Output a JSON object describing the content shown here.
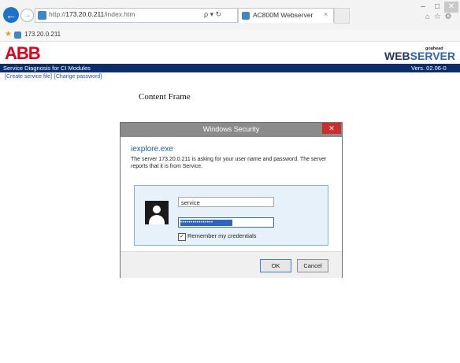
{
  "browser": {
    "window_controls": {
      "minimize": "–",
      "maximize": "□",
      "close": "✕"
    },
    "back_icon": "arrow-left-icon",
    "forward_icon": "arrow-right-icon",
    "address": {
      "prefix": "http://",
      "host": "173.20.0.211",
      "path": "/index.htm"
    },
    "address_tools": "ρ ▾ ↻",
    "tab": {
      "title": "AC800M Webserver",
      "close": "×"
    },
    "toolbar_icons": "⌂ ☆ ⚙"
  },
  "favorites": {
    "item": "173.20.0.211"
  },
  "header": {
    "logo": "ABB",
    "webserver_brand_small": "goahead",
    "webserver_brand_part1": "WEB",
    "webserver_brand_part2": "SERVER",
    "bar_left": "Service Diagnosis for CI Modules",
    "bar_right": "Vers. 02.06-0"
  },
  "links": [
    "[Create service file]",
    "[Change password]"
  ],
  "content": {
    "frame_label": "Content Frame"
  },
  "dialog": {
    "title": "Windows Security",
    "close": "✕",
    "app_name": "iexplore.exe",
    "message": "The server 173.20.0.211 is asking for your user name and password. The server reports that it is from Service.",
    "username": "service",
    "password_mask": "••••••••••••••••",
    "remember_check": "✓",
    "remember_label": "Remember my credentials",
    "ok_label": "OK",
    "cancel_label": "Cancel"
  },
  "colors": {
    "abb_red": "#e2001a",
    "header_bar": "#0b2d6b",
    "link": "#1e4fb5",
    "dialog_accent": "#1a5dac"
  }
}
